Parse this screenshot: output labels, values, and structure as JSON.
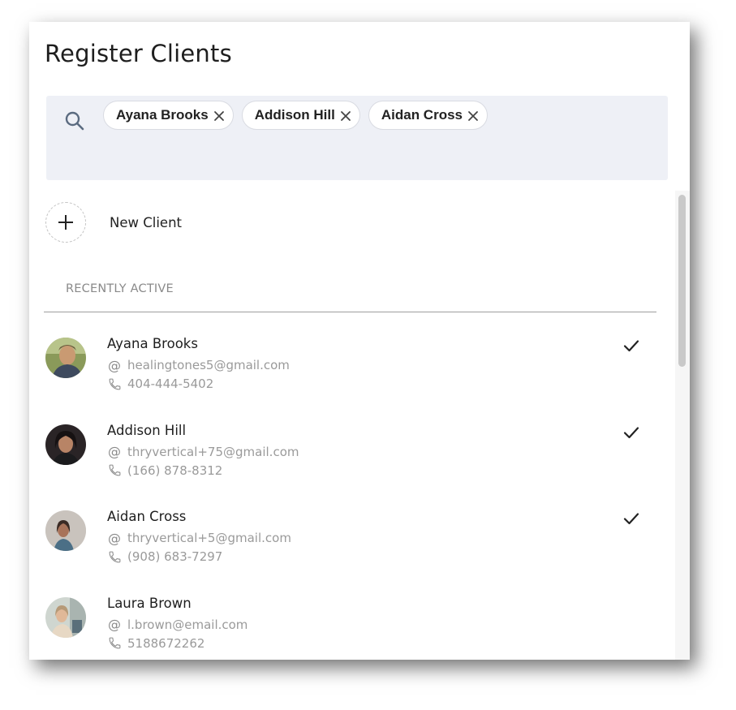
{
  "header": {
    "title": "Register Clients"
  },
  "search": {
    "icon": "search-icon",
    "selected_chips": [
      {
        "label": "Ayana Brooks"
      },
      {
        "label": "Addison Hill"
      },
      {
        "label": "Aidan Cross"
      }
    ]
  },
  "new_client": {
    "label": "New Client",
    "icon": "plus-icon"
  },
  "recent": {
    "section_label": "RECENTLY ACTIVE",
    "clients": [
      {
        "name": "Ayana Brooks",
        "email": "healingtones5@gmail.com",
        "phone": "404-444-5402",
        "selected": true
      },
      {
        "name": "Addison Hill",
        "email": "thryvertical+75@gmail.com",
        "phone": "(166) 878-8312",
        "selected": true
      },
      {
        "name": "Aidan Cross",
        "email": "thryvertical+5@gmail.com",
        "phone": "(908) 683-7297",
        "selected": true
      },
      {
        "name": "Laura Brown",
        "email": "l.brown@email.com",
        "phone": "5188672262",
        "selected": false
      }
    ]
  },
  "icons": {
    "email": "at-sign-icon",
    "phone": "phone-icon",
    "check": "checkmark-icon"
  },
  "colors": {
    "search_bg": "#eef0f6",
    "text_primary": "#1e1e1e",
    "text_secondary": "#9a9a9a"
  }
}
